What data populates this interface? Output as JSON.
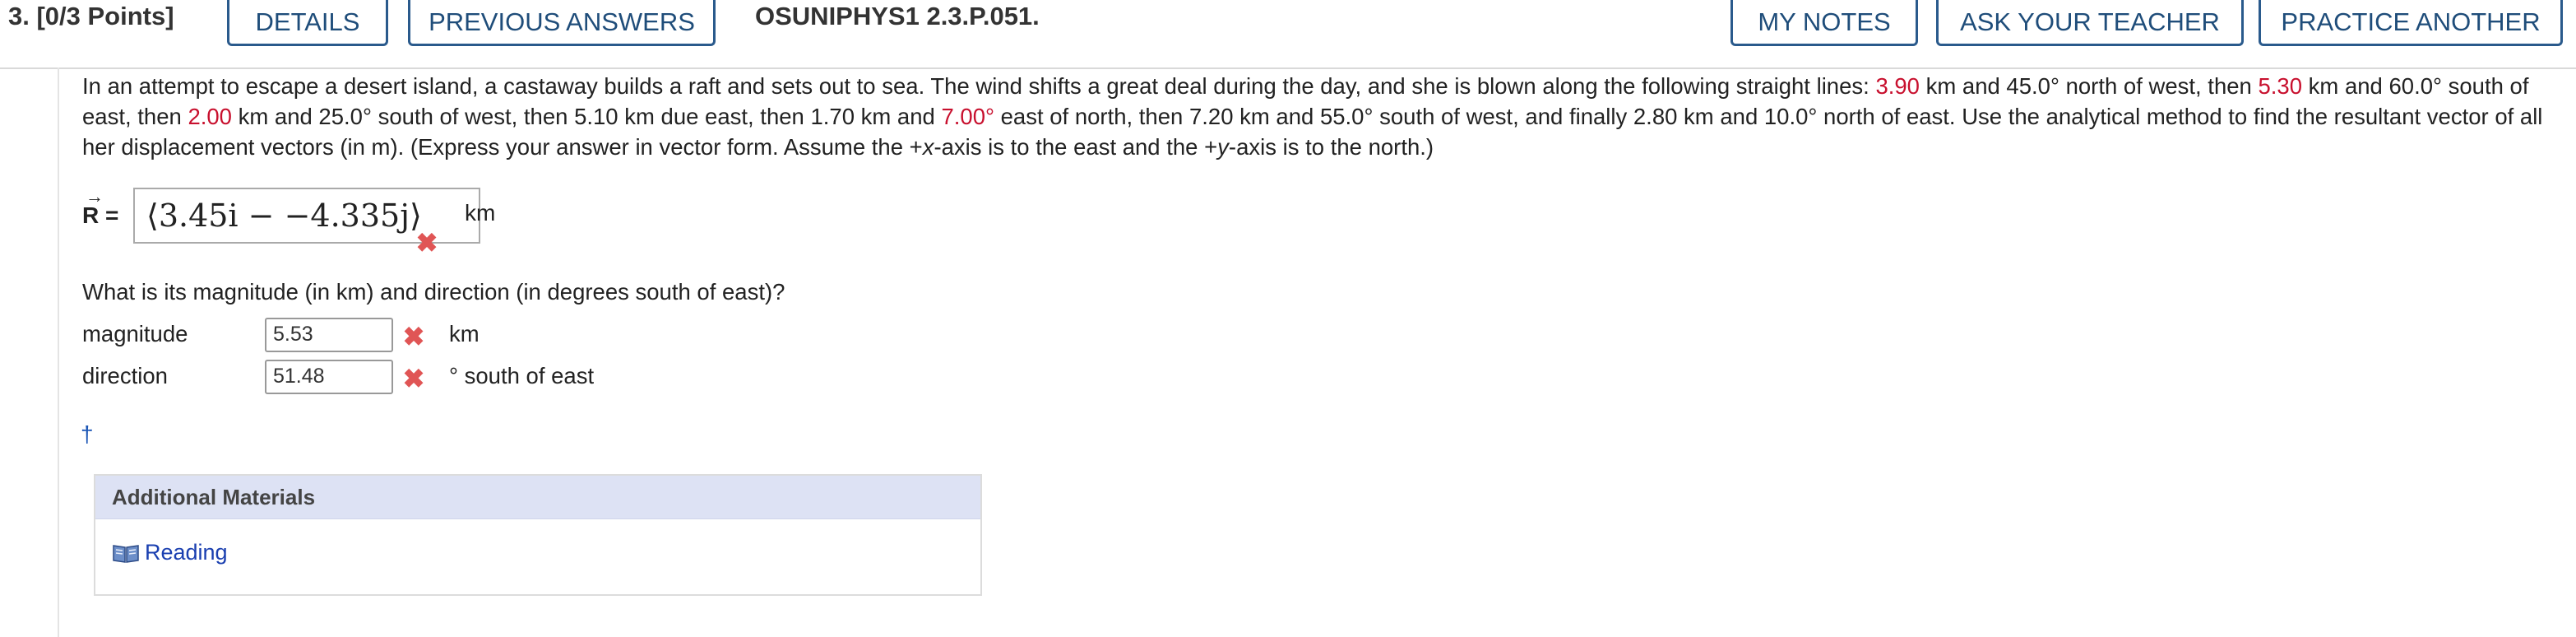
{
  "header": {
    "question_number": "3. [0/3 Points]",
    "details_label": "DETAILS",
    "previous_answers_label": "PREVIOUS ANSWERS",
    "question_id": "OSUNIPHYS1 2.3.P.051.",
    "my_notes_label": "MY NOTES",
    "ask_teacher_label": "ASK YOUR TEACHER",
    "practice_another_label": "PRACTICE ANOTHER"
  },
  "problem": {
    "p1": "In an attempt to escape a desert island, a castaway builds a raft and sets out to sea. The wind shifts a great deal during the day, and she is blown along the following straight lines: ",
    "v1": "3.90",
    "p2": " km and 45.0° north of west, then ",
    "v2": "5.30",
    "p3": " km and 60.0° south of east, then ",
    "v3": "2.00",
    "p4": " km and 25.0° south of west, then 5.10 km due east, then 1.70 km and ",
    "v4": "7.00°",
    "p5": " east of north, then 7.20 km and 55.0° south of west, and finally 2.80 km and 10.0° north of east. Use the analytical method to find the resultant vector of all her displacement vectors (in m). (Express your answer in vector form. Assume the +",
    "x_axis": "x",
    "p6": "-axis is to the east and the +",
    "y_axis": "y",
    "p7": "-axis is to the north.)"
  },
  "resultant": {
    "label": "R =",
    "arrow": "→",
    "answer": "⟨3.45i − −4.335j⟩",
    "unit": "km"
  },
  "question2": {
    "text": "What is its magnitude (in km) and direction (in degrees south of east)?",
    "magnitude_label": "magnitude",
    "magnitude_value": "5.53",
    "magnitude_unit": "km",
    "direction_label": "direction",
    "direction_value": "51.48",
    "direction_unit": "° south of east"
  },
  "footnote": "†",
  "additional_materials": {
    "title": "Additional Materials",
    "reading_label": "Reading"
  },
  "colors": {
    "highlight_red": "#c8102e",
    "incorrect_mark": "#e05555",
    "button_border": "#2a5a8c",
    "link_blue": "#1a3fb0"
  }
}
